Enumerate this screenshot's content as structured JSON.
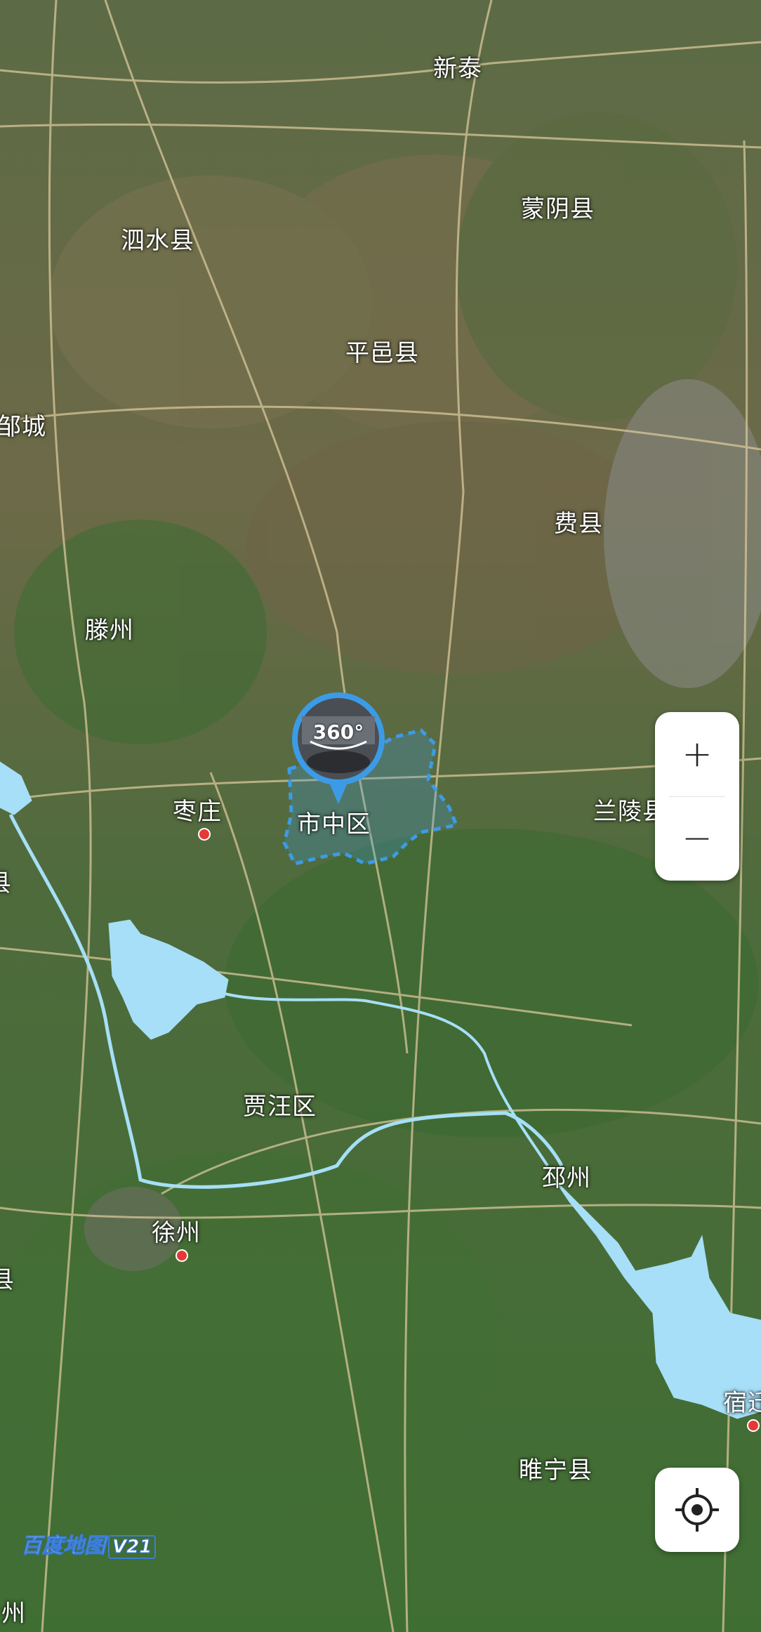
{
  "map": {
    "labels": [
      "新泰",
      "蒙阴县",
      "泗水县",
      "平邑县",
      "邹城",
      "费县",
      "滕州",
      "枣庄",
      "市中区",
      "兰陵县",
      "贾汪区",
      "邳州",
      "徐州",
      "睢宁县",
      "宿迁",
      "县",
      "县",
      "州"
    ],
    "colors": {
      "water": "#a6dff7",
      "district_outline": "#3c9be6",
      "road": "#d8c79a",
      "city_dot": "#e53935"
    }
  },
  "panorama_marker": {
    "label": "360°"
  },
  "controls": {
    "zoom_in": "+",
    "zoom_out": "−",
    "locate_icon": "crosshair-icon"
  },
  "branding": {
    "logo_text": "百度地图",
    "version": "V21"
  }
}
